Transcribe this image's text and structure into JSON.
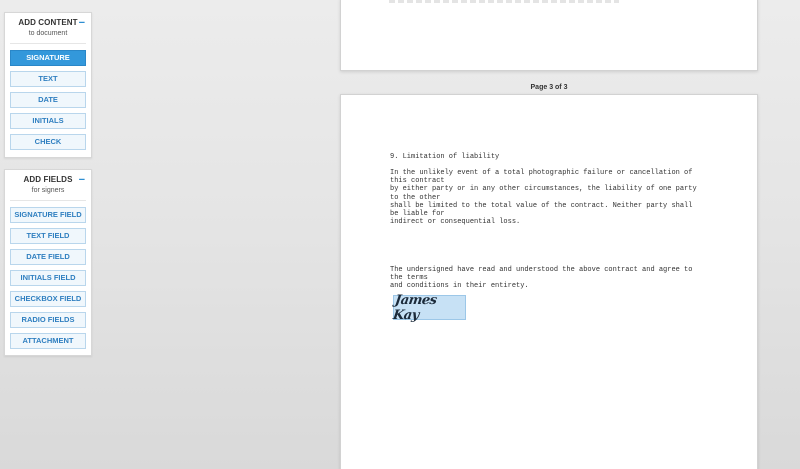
{
  "add_content": {
    "title": "ADD CONTENT",
    "subtitle": "to document",
    "collapse_icon": "−",
    "buttons": [
      "SIGNATURE",
      "TEXT",
      "DATE",
      "INITIALS",
      "CHECK"
    ]
  },
  "add_fields": {
    "title": "ADD FIELDS",
    "subtitle": "for signers",
    "collapse_icon": "−",
    "buttons": [
      "SIGNATURE FIELD",
      "TEXT FIELD",
      "DATE FIELD",
      "INITIALS FIELD",
      "CHECKBOX FIELD",
      "RADIO FIELDS",
      "ATTACHMENT"
    ]
  },
  "page_label": "Page 3 of 3",
  "document": {
    "section_heading": "9. Limitation of liability",
    "paragraph": "In the unlikely event of a total photographic failure or cancellation of\nthis contract\nby either party or in any other circumstances, the liability of one party\nto the other\nshall be limited to the total value of the contract. Neither party shall\nbe liable for\nindirect or consequential loss.",
    "acknowledgement": "The undersigned have read and understood the above contract and agree to\nthe terms\nand conditions in their entirety.",
    "signature": "James Kay"
  },
  "colors": {
    "accent": "#3398db",
    "button_bg": "#f0f7fc",
    "signature_bg": "#c7e1f5"
  }
}
